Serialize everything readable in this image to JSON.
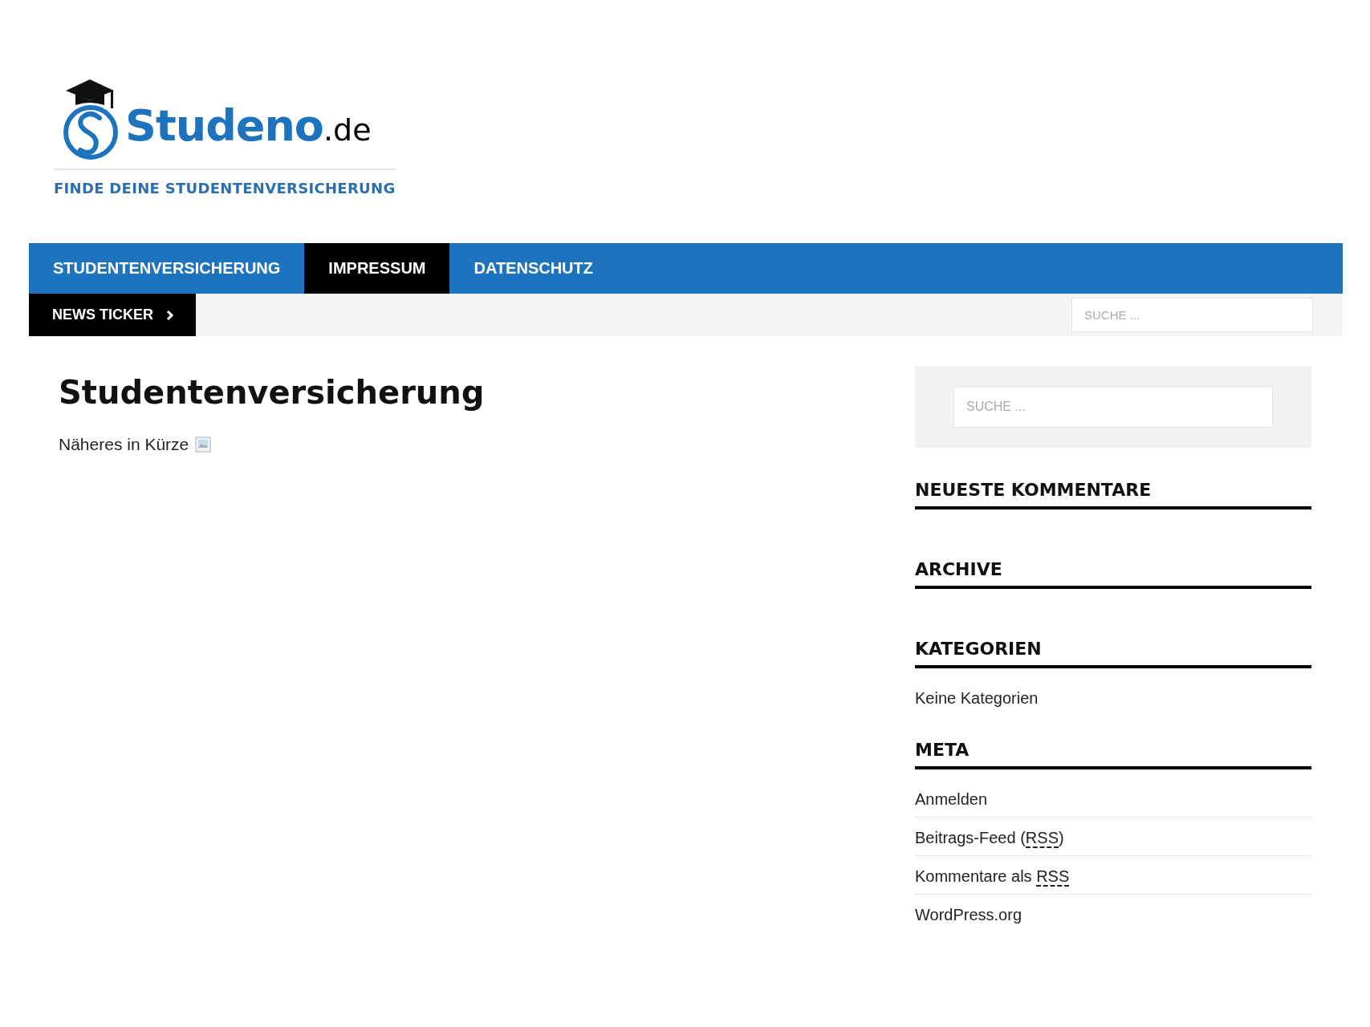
{
  "logo": {
    "name": "Studeno",
    "tld": ".de",
    "tagline": "FINDE DEINE STUDENTENVERSICHERUNG"
  },
  "nav": [
    {
      "label": "STUDENTENVERSICHERUNG",
      "selected": false
    },
    {
      "label": "IMPRESSUM",
      "selected": true
    },
    {
      "label": "DATENSCHUTZ",
      "selected": false
    }
  ],
  "ticker": {
    "label": "NEWS TICKER"
  },
  "header_search": {
    "placeholder": "SUCHE ..."
  },
  "article": {
    "title": "Studentenversicherung",
    "text": "Näheres in Kürze"
  },
  "sidebar": {
    "search": {
      "placeholder": "SUCHE ..."
    },
    "widgets": [
      {
        "title": "NEUESTE KOMMENTARE"
      },
      {
        "title": "ARCHIVE"
      },
      {
        "title": "KATEGORIEN",
        "items": [
          {
            "text": "Keine Kategorien"
          }
        ]
      },
      {
        "title": "META",
        "items": [
          {
            "text": "Anmelden"
          },
          {
            "text": "Beitrags-Feed (",
            "abbr": "RSS",
            "after": ")"
          },
          {
            "text": "Kommentare als ",
            "abbr": "RSS"
          },
          {
            "text": "WordPress.org"
          }
        ]
      }
    ]
  }
}
